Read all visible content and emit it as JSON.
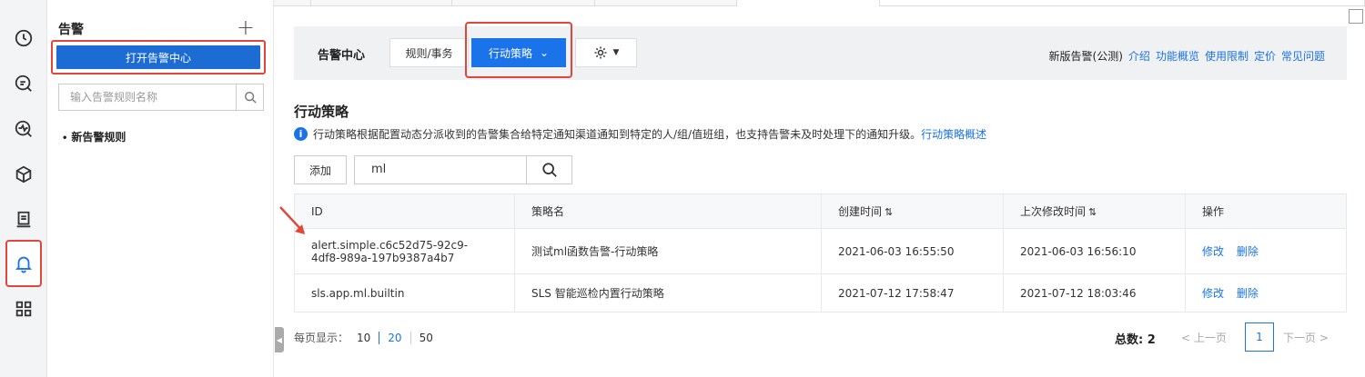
{
  "rail": {
    "icons": [
      "clock-icon",
      "search-log-icon",
      "monitor-icon",
      "box-icon",
      "report-icon",
      "bell-icon",
      "grid-icon"
    ],
    "active": "bell-icon"
  },
  "left_panel": {
    "title": "告警",
    "add_symbol": "+",
    "open_center_label": "打开告警中心",
    "search_placeholder": "输入告警规则名称",
    "items": [
      "新告警规则"
    ]
  },
  "toolbar": {
    "title": "告警中心",
    "tab_rules": "规则/事务",
    "tab_policy": "行动策略",
    "links_prefix": "新版告警(公测)",
    "links": [
      "介绍",
      "功能概览",
      "使用限制",
      "定价",
      "常见问题"
    ]
  },
  "section": {
    "title": "行动策略",
    "description": "行动策略根据配置动态分派收到的告警集合给特定通知渠道通知到特定的人/组/值班组，也支持告警未及时处理下的通知升级。",
    "description_link": "行动策略概述"
  },
  "filter": {
    "add_label": "添加",
    "query": "ml"
  },
  "table": {
    "columns": [
      "ID",
      "策略名",
      "创建时间",
      "上次修改时间",
      "操作"
    ],
    "rows": [
      {
        "id_line1": "alert.simple.c6c52d75-92c9-",
        "id_line2": "4df8-989a-197b9387a4b7",
        "name": "测试ml函数告警-行动策略",
        "created": "2021-06-03 16:55:50",
        "modified": "2021-06-03 16:56:10",
        "edit": "修改",
        "delete": "删除"
      },
      {
        "id_line1": "sls.app.ml.builtin",
        "id_line2": "",
        "name": "SLS 智能巡检内置行动策略",
        "created": "2021-07-12 17:58:47",
        "modified": "2021-07-12 18:03:46",
        "edit": "修改",
        "delete": "删除"
      }
    ]
  },
  "pagination": {
    "per_page_label": "每页显示：",
    "sizes": [
      "10",
      "20",
      "50"
    ],
    "current_size": "20",
    "total_label": "总数: 2",
    "prev": "上一页",
    "next": "下一页",
    "current_page": "1"
  },
  "colors": {
    "accent": "#1a73e8",
    "highlight": "#e0463a"
  }
}
